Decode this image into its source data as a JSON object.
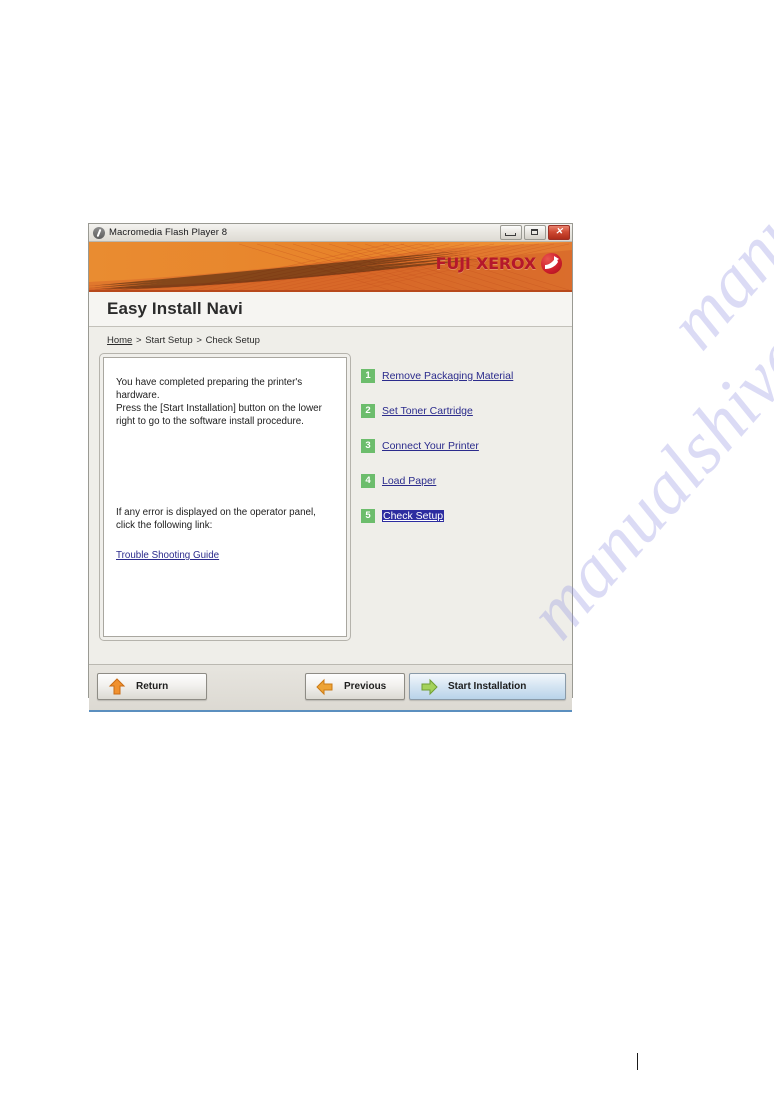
{
  "window": {
    "title": "Macromedia Flash Player 8",
    "app_icon": "flash-player-icon",
    "controls": {
      "minimize": "minimize-icon",
      "maximize": "maximize-icon",
      "close": "close-icon",
      "close_glyph": "✕"
    }
  },
  "banner": {
    "brand": "FUJI XEROX",
    "brand_color": "#b5182b",
    "banner_color": "#e8832a",
    "logo_icon": "fuji-xerox-sphere-logo"
  },
  "header": {
    "title": "Easy Install Navi"
  },
  "breadcrumb": {
    "items": [
      {
        "label": "Home",
        "link": true
      },
      {
        "label": "Start Setup",
        "link": false
      },
      {
        "label": "Check Setup",
        "link": false
      }
    ],
    "separator": ">"
  },
  "info_panel": {
    "paragraph_top": "You have completed preparing the printer's hardware.\nPress the [Start Installation] button on the lower right to go to the software install procedure.",
    "paragraph_lower": "If any error is displayed on the operator panel, click the following link:",
    "link_label": "Trouble Shooting Guide",
    "link_color": "#2b2b8c"
  },
  "steps": {
    "badge_color": "#6cbd6c",
    "link_color": "#2b2b8c",
    "selected_highlight": "#2c2ca0",
    "items": [
      {
        "number": "1",
        "label": "Remove Packaging Material",
        "selected": false
      },
      {
        "number": "2",
        "label": "Set Toner Cartridge",
        "selected": false
      },
      {
        "number": "3",
        "label": "Connect Your Printer",
        "selected": false
      },
      {
        "number": "4",
        "label": "Load Paper",
        "selected": false
      },
      {
        "number": "5",
        "label": "Check Setup",
        "selected": true
      }
    ]
  },
  "footer": {
    "buttons": [
      {
        "id": "return",
        "label": "Return",
        "icon": "arrow-up-icon",
        "icon_color": "#ef8a33"
      },
      {
        "id": "previous",
        "label": "Previous",
        "icon": "arrow-left-icon",
        "icon_color": "#e9a03a"
      },
      {
        "id": "start",
        "label": "Start Installation",
        "icon": "arrow-right-icon",
        "icon_color": "#9ccc56"
      }
    ]
  },
  "page": {
    "watermark": "manualshive.com"
  }
}
